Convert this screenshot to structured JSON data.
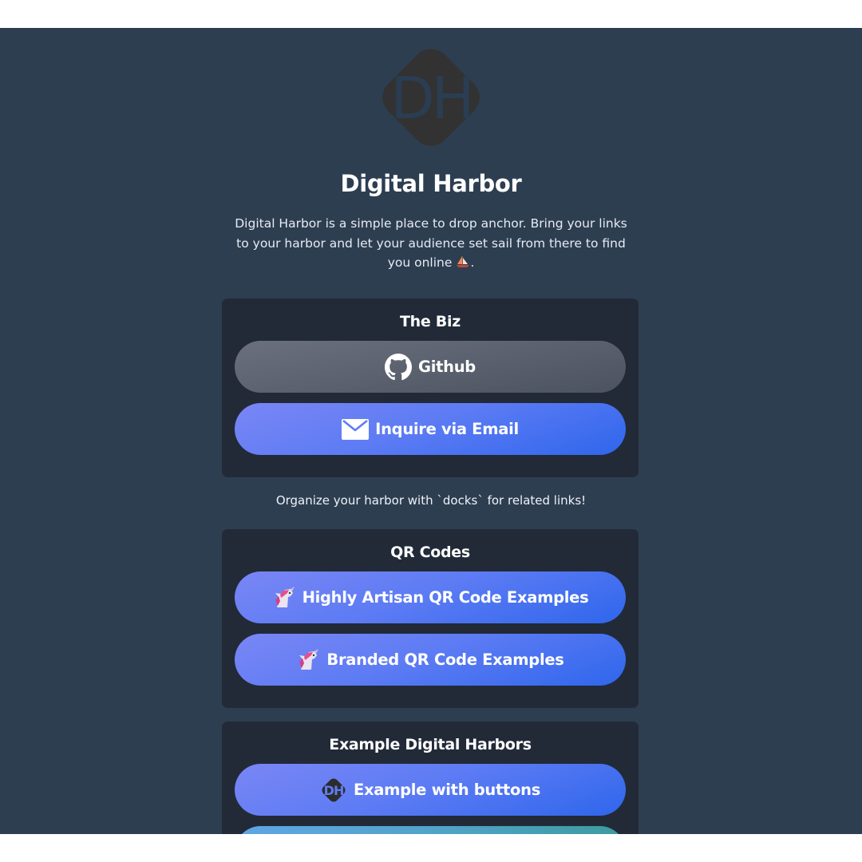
{
  "colors": {
    "page_background": "#2e3e51",
    "dock_background": "#222a38",
    "button_blue": "#5e7cf4",
    "button_gray": "#5b616d",
    "button_teal": "#4fa3c5",
    "text": "#ffffff"
  },
  "profile": {
    "logo_text": "DH",
    "logo_icon": "digital-harbor-logo-icon",
    "title": "Digital Harbor",
    "description": "Digital Harbor is a simple place to drop anchor. Bring your links to your harbor and let your audience set sail from there to find you online",
    "description_end": ".",
    "description_emoji_icon": "sailboat-icon"
  },
  "docks": [
    {
      "title": "The Biz",
      "links": [
        {
          "label": "Github",
          "icon": "github-icon",
          "style": "gray"
        },
        {
          "label": "Inquire via Email",
          "icon": "envelope-icon",
          "style": "blue"
        }
      ]
    },
    {
      "title": "QR Codes",
      "links": [
        {
          "label": "Highly Artisan QR Code Examples",
          "icon": "unicorn-icon",
          "style": "blue"
        },
        {
          "label": "Branded QR Code Examples",
          "icon": "unicorn-icon",
          "style": "blue"
        }
      ]
    },
    {
      "title": "Example Digital Harbors",
      "links": [
        {
          "label": "Example with buttons",
          "icon": "digital-harbor-logo-icon",
          "style": "blue",
          "icon_text": "DH"
        },
        {
          "label": "",
          "icon": "",
          "style": "teal"
        }
      ]
    }
  ],
  "between_text": "Organize your harbor with `docks` for related links!"
}
